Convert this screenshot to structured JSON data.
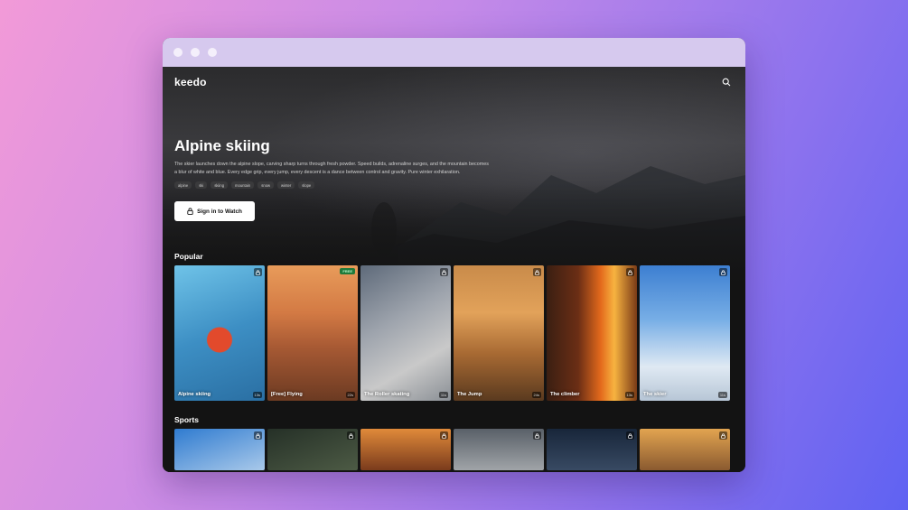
{
  "app": {
    "logo": "keedo"
  },
  "hero": {
    "title": "Alpine skiing",
    "description": "The skier launches down the alpine slope, carving sharp turns through fresh powder. Speed builds, adrenaline surges, and the mountain becomes a blur of white and blue. Every edge grip, every jump, every descent is a dance between control and gravity. Pure winter exhilaration.",
    "tags": [
      "alpine",
      "ski",
      "skiing",
      "mountain",
      "snow",
      "winter",
      "slope"
    ],
    "cta_label": "Sign in to Watch"
  },
  "sections": [
    {
      "title": "Popular",
      "cards": [
        {
          "label": "Alpine skiing",
          "duration": "13s",
          "badge": "lock"
        },
        {
          "label": "[Free] Flying",
          "duration": "22s",
          "badge": "FREE"
        },
        {
          "label": "The Roller skating",
          "duration": "11s",
          "badge": "lock"
        },
        {
          "label": "The Jump",
          "duration": "24s",
          "badge": "lock"
        },
        {
          "label": "The climber",
          "duration": "13s",
          "badge": "lock"
        },
        {
          "label": "The skier",
          "duration": "11s",
          "badge": "lock"
        }
      ]
    },
    {
      "title": "Sports",
      "cards": [
        {
          "badge": "lock"
        },
        {
          "badge": "lock"
        },
        {
          "badge": "lock"
        },
        {
          "badge": "lock"
        },
        {
          "badge": "lock"
        },
        {
          "badge": "lock"
        }
      ]
    }
  ],
  "colors": {
    "accent": "#ffffff",
    "background": "#131313",
    "free_badge": "#1f7a3a"
  }
}
